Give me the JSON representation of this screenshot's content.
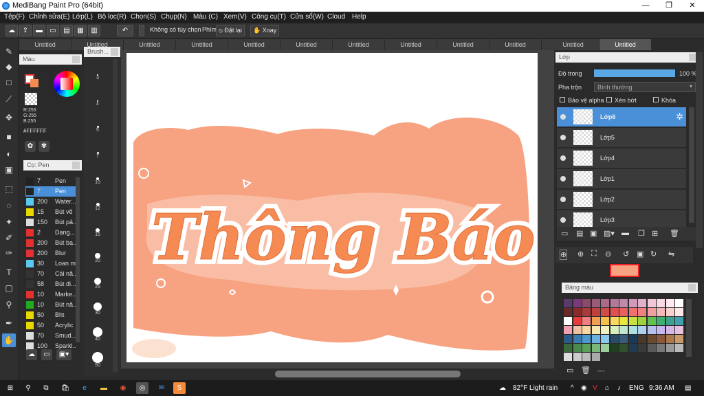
{
  "window": {
    "title": "MediBang Paint Pro (64bit)"
  },
  "menu": [
    "Tệp(F)",
    "Chỉnh sửa(E)",
    "Lớp(L)",
    "Bộ lọc(R)",
    "Chọn(S)",
    "Chụp(N)",
    "Màu (C)",
    "Xem(V)",
    "Công cụ(T)",
    "Cửa sổ(W)",
    "Cloud",
    "Help"
  ],
  "toolbar": {
    "selection_label": "Không có tùy chọn",
    "key_label": "Phím",
    "reset_label": "Đặt lại",
    "rotate_label": "Xoay"
  },
  "tabs": [
    "Untitled",
    "Untitled",
    "Untitled",
    "Untitled",
    "Untitled",
    "Untitled",
    "Untitled",
    "Untitled",
    "Untitled",
    "Untitled",
    "Untitled",
    "Untitled"
  ],
  "color_panel": {
    "title": "Màu",
    "r": "R:255",
    "g": "G:255",
    "b": "B:255",
    "hex": "#FFFFFF"
  },
  "brush_panel": {
    "title": "Cọ: Pen",
    "size_title": "Brush..."
  },
  "brushes": [
    {
      "size": "7",
      "name": "Pen",
      "color": "#222222"
    },
    {
      "size": "7",
      "name": "Pen",
      "color": "#222222",
      "selected": true
    },
    {
      "size": "200",
      "name": "Water...",
      "color": "#5bc8f0"
    },
    {
      "size": "15",
      "name": "Bút vẽ",
      "color": "#e8d800"
    },
    {
      "size": "150",
      "name": "Bút pả...",
      "color": "#dddddd"
    },
    {
      "size": "2",
      "name": "Dạng...",
      "color": "#e53030"
    },
    {
      "size": "200",
      "name": "Bút bạ...",
      "color": "#e53030"
    },
    {
      "size": "200",
      "name": "Blur",
      "color": "#e53030"
    },
    {
      "size": "30",
      "name": "Loan m...",
      "color": "#5bc8f0"
    },
    {
      "size": "70",
      "name": "Cái nă...",
      "color": "#333333"
    },
    {
      "size": "58",
      "name": "Bút đi...",
      "color": "#333333"
    },
    {
      "size": "10",
      "name": "Marke...",
      "color": "#e53030"
    },
    {
      "size": "10",
      "name": "Bút nă...",
      "color": "#22aa22"
    },
    {
      "size": "50",
      "name": "Bht",
      "color": "#e8d800"
    },
    {
      "size": "50",
      "name": "Acrylic",
      "color": "#e8d800"
    },
    {
      "size": "70",
      "name": "Smud...",
      "color": "#dddddd"
    },
    {
      "size": "100",
      "name": "Sparkl...",
      "color": "#dddddd"
    }
  ],
  "brush_sizes": [
    "3",
    "4",
    "5",
    "7",
    "10",
    "12",
    "15",
    "20",
    "25",
    "30",
    "40",
    "50"
  ],
  "canvas": {
    "text_line1": "Thông Báo",
    "accent": "#f7a381",
    "text_color": "#f58a52"
  },
  "layer_panel": {
    "title": "Lớp",
    "opacity_label": "Độ trong",
    "opacity_value": "100 %",
    "blend_label": "Pha trộn",
    "blend_value": "Bình thường",
    "protect_alpha": "Bảo vệ alpha",
    "clip": "Xén bớt",
    "lock": "Khóa"
  },
  "layers": [
    {
      "name": "Lớp6",
      "selected": true
    },
    {
      "name": "Lớp5"
    },
    {
      "name": "Lớp4"
    },
    {
      "name": "Lớp1"
    },
    {
      "name": "Lớp2"
    },
    {
      "name": "Lớp3"
    }
  ],
  "palette_panel": {
    "title": "Bảng màu",
    "footer": "----"
  },
  "taskbar": {
    "weather": "82°F  Light rain",
    "lang": "ENG",
    "time": "9:36 AM"
  }
}
